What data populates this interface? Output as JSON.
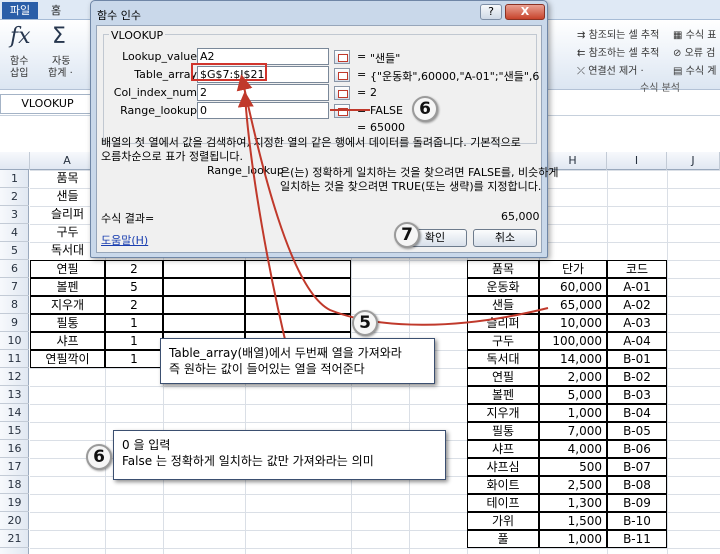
{
  "ribbon": {
    "tab_file": "파일",
    "tab_home": "홈",
    "fx_symbol": "fx",
    "fx_label_1": "함수",
    "fx_label_2": "삽입",
    "sigma_symbol": "Σ",
    "autosum_1": "자동",
    "autosum_2": "합계 ·",
    "trace_precedents": "참조되는 셀 추적",
    "trace_dependents": "참조하는 셀 추적",
    "remove_arrows": "연결선 제거 ·",
    "show_formulas": "수식 표",
    "error_check": "오류 검",
    "evaluate_formula": "수식 계",
    "group_label": "수식 분석"
  },
  "namebox": "VLOOKUP",
  "columns": [
    "A",
    "B",
    "C",
    "D",
    "E",
    "F",
    "G",
    "H",
    "I",
    "J"
  ],
  "rows": [
    "1",
    "2",
    "3",
    "4",
    "5",
    "6",
    "7",
    "8",
    "9",
    "10",
    "11",
    "12",
    "13",
    "14",
    "15",
    "16",
    "17",
    "18",
    "19",
    "20",
    "21"
  ],
  "left_table": [
    [
      "품목",
      ""
    ],
    [
      "샌들",
      ""
    ],
    [
      "슬리퍼",
      ""
    ],
    [
      "구두",
      ""
    ],
    [
      "독서대",
      ""
    ],
    [
      "연필",
      "2"
    ],
    [
      "볼펜",
      "5"
    ],
    [
      "지우개",
      "2"
    ],
    [
      "필통",
      "1"
    ],
    [
      "샤프",
      "1"
    ],
    [
      "연필깍이",
      "1"
    ]
  ],
  "price_table": {
    "headers": [
      "품목",
      "단가",
      "코드"
    ],
    "rows": [
      [
        "운동화",
        "60,000",
        "A-01"
      ],
      [
        "샌들",
        "65,000",
        "A-02"
      ],
      [
        "슬리퍼",
        "10,000",
        "A-03"
      ],
      [
        "구두",
        "100,000",
        "A-04"
      ],
      [
        "독서대",
        "14,000",
        "B-01"
      ],
      [
        "연필",
        "2,000",
        "B-02"
      ],
      [
        "볼펜",
        "5,000",
        "B-03"
      ],
      [
        "지우개",
        "1,000",
        "B-04"
      ],
      [
        "필통",
        "7,000",
        "B-05"
      ],
      [
        "샤프",
        "4,000",
        "B-06"
      ],
      [
        "샤프심",
        "500",
        "B-07"
      ],
      [
        "화이트",
        "2,500",
        "B-08"
      ],
      [
        "테이프",
        "1,300",
        "B-09"
      ],
      [
        "가위",
        "1,500",
        "B-10"
      ],
      [
        "풀",
        "1,000",
        "B-11"
      ]
    ]
  },
  "dialog": {
    "title": "함수 인수",
    "help_btn": "?",
    "close_btn": "X",
    "function_name": "VLOOKUP",
    "args": [
      {
        "label": "Lookup_value",
        "value": "A2",
        "result": "\"샌들\""
      },
      {
        "label": "Table_array",
        "value": "$G$7:$I$21",
        "result": "{\"운동화\",60000,\"A-01\";\"샌들\",65000,"
      },
      {
        "label": "Col_index_num",
        "value": "2",
        "result": "2"
      },
      {
        "label": "Range_lookup",
        "value": "0",
        "result": "FALSE"
      }
    ],
    "result_value": "65000",
    "description_1": "배열의 첫 열에서 값을 검색하여, 지정한 열의 같은 행에서 데이터를 돌려줍니다. 기본적으로",
    "description_2": "오름차순으로 표가 정렬됩니다.",
    "arg_help_name": "Range_lookup",
    "arg_help_1": "은(는) 정확하게 일치하는 것을 찾으려면 FALSE를, 비슷하게",
    "arg_help_2": "일치하는 것을 찾으려면 TRUE(또는 생략)를 지정합니다.",
    "formula_result_label": "수식 결과=",
    "formula_result_value": "65,000",
    "help_link": "도움말(H)",
    "ok_label": "확인",
    "cancel_label": "취소"
  },
  "annotations": {
    "badge_top_6": "6",
    "badge_7": "7",
    "badge_5": "5",
    "badge_bottom_6": "6",
    "callout_5_line1": "Table_array(배열)에서 두번째 열을 가져와라",
    "callout_5_line2": "즉 원하는 값이 들어있는 열을 적어준다",
    "callout_6_line1": "0 을 입력",
    "callout_6_line2": "False 는 정확하게 일치하는 값만 가져와라는 의미"
  }
}
